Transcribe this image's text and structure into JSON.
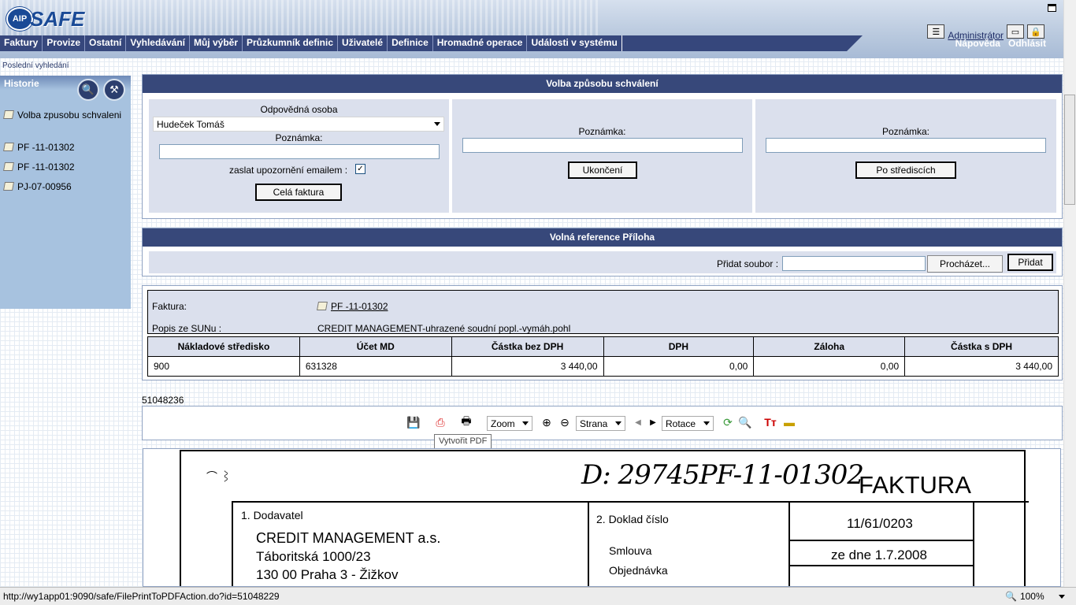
{
  "header": {
    "logo_badge": "AIP",
    "logo_word": "SAFE",
    "user": "Administrátor",
    "help": "Nápověda",
    "logout": "Odhlásit",
    "menu": [
      "Faktury",
      "Provize",
      "Ostatní",
      "Vyhledávání",
      "Můj výběr",
      "Průzkumník definic",
      "Uživatelé",
      "Definice",
      "Hromadné operace",
      "Události v systému"
    ]
  },
  "sidebar": {
    "breadcrumb": "Poslední vyhledání",
    "title": "Historie",
    "items": [
      "Volba zpusobu schvaleni",
      "PF -11-01302",
      "PF -11-01302",
      "PJ-07-00956"
    ]
  },
  "approval": {
    "title": "Volba způsobu schválení",
    "responsible_label": "Odpovědná osoba",
    "responsible_value": "Hudeček Tomáš",
    "note_label": "Poznámka:",
    "email_label": "zaslat upozornění emailem :",
    "email_checked": true,
    "btn_full": "Celá faktura",
    "btn_end": "Ukončení",
    "btn_centers": "Po střediscích"
  },
  "attachment": {
    "title": "Volná reference Příloha",
    "add_file_label": "Přidat soubor :",
    "browse": "Procházet...",
    "add": "Přidat"
  },
  "invoice": {
    "invoice_label": "Faktura:",
    "invoice_link": "PF -11-01302",
    "sun_label": "Popis ze SUNu :",
    "sun_value": "CREDIT MANAGEMENT-uhrazené soudní popl.-vymáh.pohl",
    "columns": [
      "Nákladové středisko",
      "Účet MD",
      "Částka bez DPH",
      "DPH",
      "Záloha",
      "Částka s DPH"
    ],
    "row": [
      "900",
      "631328",
      "3 440,00",
      "0,00",
      "0,00",
      "3 440,00"
    ]
  },
  "viewer": {
    "doc_id": "51048236",
    "zoom": "Zoom",
    "page": "Strana",
    "rotate": "Rotace",
    "tooltip": "Vytvořit PDF"
  },
  "document": {
    "handwriting": "D: 29745PF-11-01302",
    "heading": "FAKTURA",
    "supplier_label": "1. Dodavatel",
    "supplier_name": "CREDIT MANAGEMENT a.s.",
    "supplier_street": "Táboritská 1000/23",
    "supplier_city": "130 00 Praha 3 - Žižkov",
    "doc_num_label": "2. Doklad číslo",
    "doc_num_value": "11/61/0203",
    "contract_label": "Smlouva",
    "order_label": "Objednávka",
    "date_value": "ze dne 1.7.2008"
  },
  "status": {
    "url": "http://wy1app01:9090/safe/FilePrintToPDFAction.do?id=51048229",
    "zoom": "100%"
  },
  "colors": {
    "nav": "#36477c",
    "panel_title": "#37487a",
    "sidebar": "#a7c2df",
    "subbox": "#dbe0ed"
  }
}
